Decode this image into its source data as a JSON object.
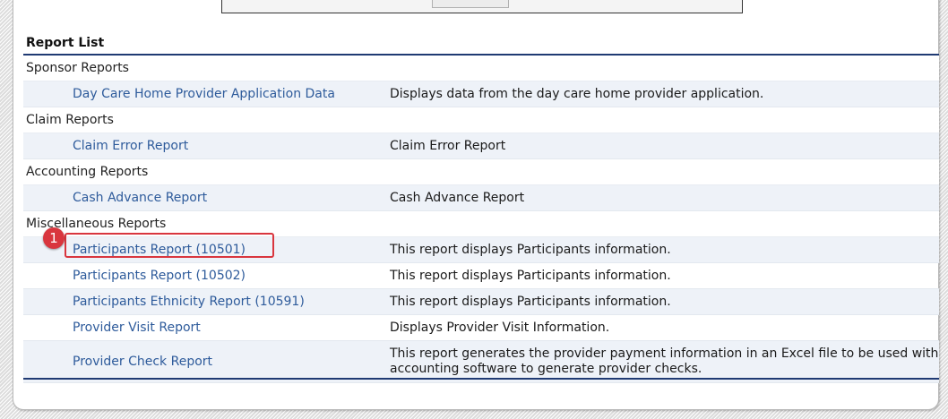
{
  "report_list": {
    "title": "Report List",
    "groups": [
      {
        "name": "Sponsor Reports",
        "items": [
          {
            "label": "Day Care Home Provider Application Data",
            "description": "Displays data from the day care home provider application."
          }
        ]
      },
      {
        "name": "Claim Reports",
        "items": [
          {
            "label": "Claim Error Report",
            "description": "Claim Error Report"
          }
        ]
      },
      {
        "name": "Accounting Reports",
        "items": [
          {
            "label": "Cash Advance Report",
            "description": "Cash Advance Report"
          }
        ]
      },
      {
        "name": "Miscellaneous Reports",
        "items": [
          {
            "label": "Participants Report (10501)",
            "description": "This report displays Participants information."
          },
          {
            "label": "Participants Report (10502)",
            "description": "This report displays Participants information."
          },
          {
            "label": "Participants Ethnicity Report (10591)",
            "description": "This report displays Participants information."
          },
          {
            "label": "Provider Visit Report",
            "description": "Displays Provider Visit Information."
          },
          {
            "label": "Provider Check Report",
            "description": "This report generates the provider payment information in an Excel file to be used with accounting software to generate provider checks."
          }
        ]
      }
    ]
  },
  "annotation": {
    "badge": "1"
  },
  "colors": {
    "link": "#2e5b9b",
    "rule": "#1f3a73",
    "highlight": "#d9363e",
    "row_shade": "#eef2f8"
  }
}
